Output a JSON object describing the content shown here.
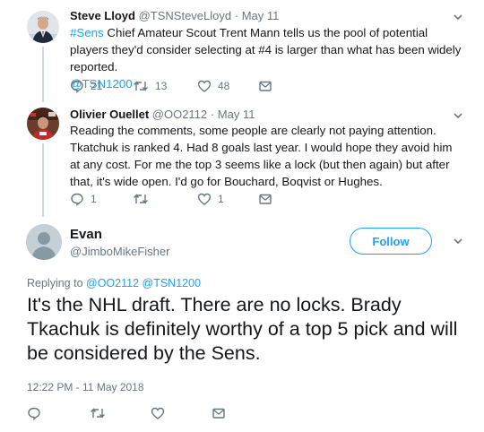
{
  "tweet1": {
    "name": "Steve Lloyd",
    "handle": "@TSNSteveLloyd",
    "sep": "·",
    "date": "May 11",
    "hashtag": "#Sens",
    "text": " Chief Amateur Scout Trent Mann tells us the pool of potential players they'd consider selecting at #4 is larger than what has been widely reported.",
    "mention": "@TSN1200",
    "replies": "21",
    "retweets": "13",
    "likes": "48"
  },
  "tweet2": {
    "name": "Olivier Ouellet",
    "handle": "@OO2112",
    "sep": "·",
    "date": "May 11",
    "text": "Reading the comments, some people are clearly not paying attention. Tkatchuk is ranked 4. Had 8 goals last year. I would hope they avoid him at any cost. For me the top 3 seems like a lock (but then again) but after that, it's wide open. I'd go for Bouchard, Boqvist or Hughes.",
    "replies": "1",
    "retweets": "",
    "likes": "1"
  },
  "main": {
    "name": "Evan",
    "handle": "@JimboMikeFisher",
    "follow_label": "Follow",
    "replying_prefix": "Replying to ",
    "replying_to_1": "@OO2112",
    "replying_to_2": "@TSN1200",
    "text": "It's the NHL draft. There are no locks. Brady Tkachuk is definitely worthy of a top 5 pick and will be considered by the Sens.",
    "timestamp": "12:22 PM - 11 May 2018"
  },
  "colors": {
    "accent": "#1da1f2",
    "secondary_text": "#657786",
    "primary_text": "#14171a",
    "thread_line": "#cfd9de"
  },
  "icons": [
    "reply-icon",
    "retweet-icon",
    "like-icon",
    "direct-message-icon",
    "chevron-down-icon"
  ]
}
